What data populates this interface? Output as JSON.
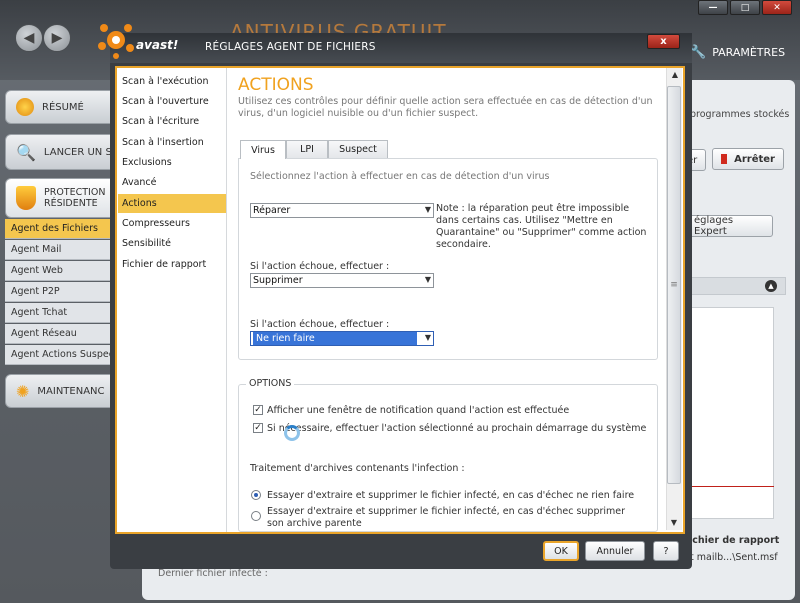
{
  "app": {
    "name_fragment": "ANTIVIRUS GRATUIT",
    "parametres": "PARAMÈTRES"
  },
  "sidebar": {
    "resume": "RÉSUMÉ",
    "lancer": "LANCER UN SC",
    "protection_line1": "PROTECTION",
    "protection_line2": "RÉSIDENTE",
    "maintenance": "MAINTENANC",
    "agents": [
      "Agent des Fichiers",
      "Agent Mail",
      "Agent Web",
      "Agent P2P",
      "Agent Tchat",
      "Agent Réseau",
      "Agent Actions Suspect"
    ]
  },
  "background_panel": {
    "right_text": "programmes stockés",
    "stop_button_partial": "er",
    "stop_button": "Arrêter",
    "expert_button": "églages Expert",
    "report_label": "ichier de rapport",
    "report_path": "t mailb...\\Sent.msf",
    "last_infected": "Dernier fichier infecté :"
  },
  "dialog": {
    "logo": "avast!",
    "title": "RÉGLAGES AGENT DE FICHIERS",
    "close": "x",
    "nav": [
      "Scan à l'exécution",
      "Scan à l'ouverture",
      "Scan à l'écriture",
      "Scan à l'insertion",
      "Exclusions",
      "Avancé",
      "Actions",
      "Compresseurs",
      "Sensibilité",
      "Fichier de rapport"
    ],
    "heading": "ACTIONS",
    "description": "Utilisez ces contrôles pour définir quelle action sera effectuée en cas de détection d'un virus, d'un logiciel nuisible ou d'un fichier suspect.",
    "tabs": [
      "Virus",
      "LPI",
      "Suspect"
    ],
    "select_action_label": "Sélectionnez l'action à effectuer en cas de détection d'un virus",
    "action1": "Réparer",
    "note": "Note : la réparation peut être impossible dans certains cas. Utilisez \"Mettre en Quarantaine\" ou \"Supprimer\" comme action secondaire.",
    "fail_label_1": "Si l'action échoue, effectuer :",
    "action2": "Supprimer",
    "fail_label_2": "Si l'action échoue, effectuer :",
    "action3": "Ne rien faire",
    "options_title": "OPTIONS",
    "opt1": "Afficher une fenêtre de notification quand l'action est effectuée",
    "opt2": "Si nécessaire, effectuer l'action sélectionné au prochain démarrage du système",
    "archives_label": "Traitement d'archives contenants l'infection :",
    "radio1": "Essayer d'extraire et supprimer le fichier infecté, en cas d'échec ne rien faire",
    "radio2": "Essayer d'extraire et supprimer le fichier infecté, en cas d'échec supprimer son archive parente",
    "ok": "OK",
    "cancel": "Annuler",
    "help": "?"
  }
}
